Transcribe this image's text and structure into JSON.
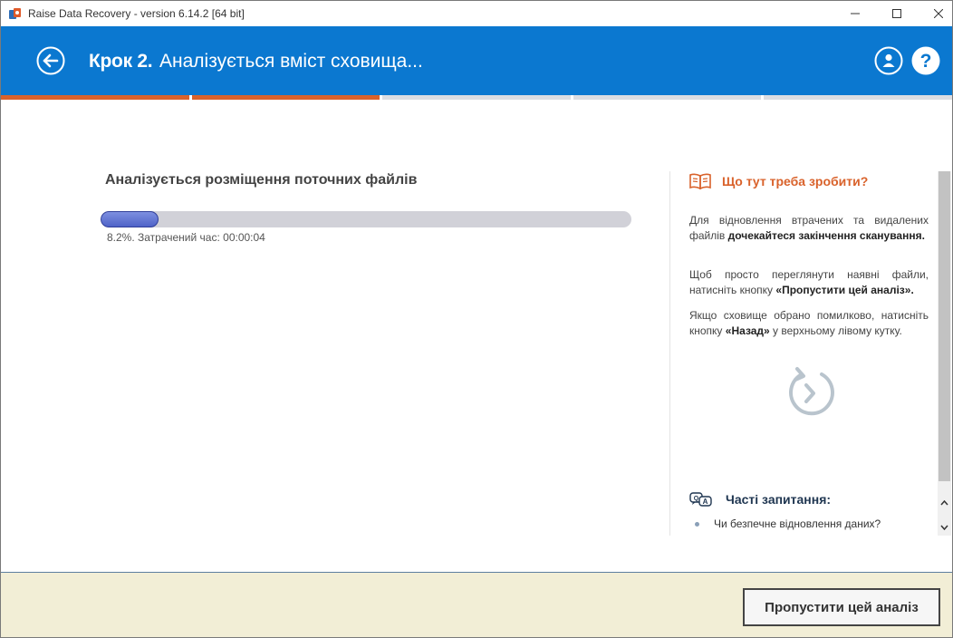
{
  "window": {
    "title": "Raise Data Recovery - version 6.14.2 [64 bit]"
  },
  "header": {
    "step_label": "Крок 2.",
    "step_title": "Аналізується вміст сховища..."
  },
  "steps": {
    "total": 5,
    "completed": 2
  },
  "main": {
    "task_title": "Аналізується розміщення поточних файлів",
    "progress_fraction": 0.082,
    "progress_text": "8.2%. Затрачений час: 00:00:04"
  },
  "side": {
    "heading": "Що тут треба зробити?",
    "p1_a": "Для відновлення втрачених та видалених файлів ",
    "p1_b": "дочекайтеся закінчення сканування.",
    "p2_a": "Щоб просто переглянути наявні файли, натисніть кнопку ",
    "p2_b": "«Пропустити цей аналіз».",
    "p3_a": "Якщо сховище обрано помилково, натисніть кнопку ",
    "p3_b": "«Назад»",
    "p3_c": " у верхньому лівому кутку.",
    "faq_heading": "Часті запитання:",
    "faq_items": [
      "Чи безпечне відновлення даних?"
    ]
  },
  "footer": {
    "skip_label": "Пропустити цей аналіз"
  },
  "colors": {
    "header_bg": "#0b78d0",
    "accent_orange": "#d9622b",
    "footer_bg": "#f2eed6",
    "progress_fill": "#5a6ed0"
  }
}
